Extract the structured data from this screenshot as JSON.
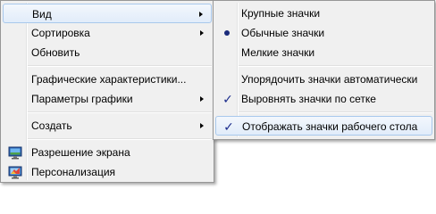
{
  "context_menu": {
    "view": "Вид",
    "sort": "Сортировка",
    "refresh": "Обновить",
    "graphics_properties": "Графические характеристики...",
    "graphics_options": "Параметры графики",
    "create": "Создать",
    "screen_resolution": "Разрешение экрана",
    "personalization": "Персонализация"
  },
  "view_submenu": {
    "large_icons": "Крупные значки",
    "medium_icons": "Обычные значки",
    "small_icons": "Мелкие значки",
    "auto_arrange": "Упорядочить значки автоматически",
    "align_to_grid": "Выровнять значки по сетке",
    "show_desktop_icons": "Отображать значки рабочего стола"
  },
  "marks": {
    "selected_size": "Обычные значки",
    "check_glyph": "✓"
  },
  "colors": {
    "menu_bg": "#f0f0f0",
    "highlight_border": "#a8c8ec",
    "check": "#1c2c8c"
  }
}
